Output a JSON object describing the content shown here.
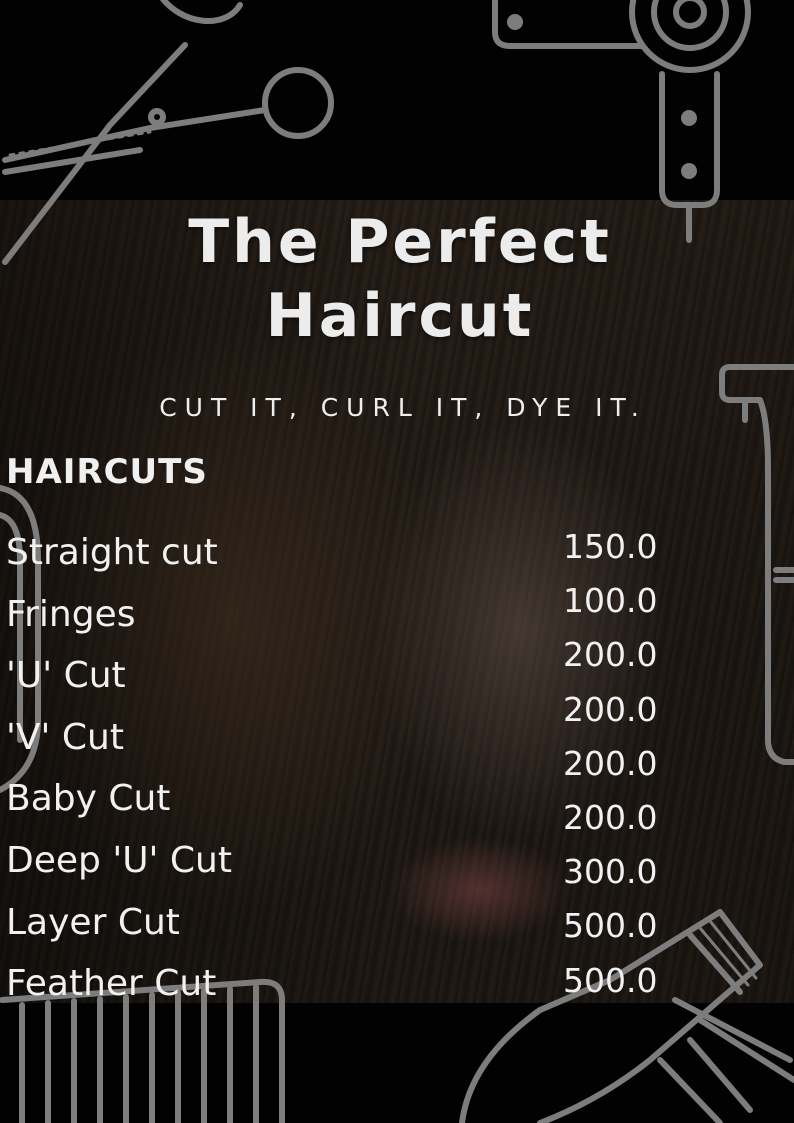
{
  "title_line1": "The Perfect",
  "title_line2": "Haircut",
  "tagline": "CUT IT, CURL IT, DYE IT.",
  "section": "HAIRCUTS",
  "menu": [
    {
      "name": "Straight cut",
      "price": "150.0"
    },
    {
      "name": "Fringes",
      "price": "100.0"
    },
    {
      "name": "'U' Cut",
      "price": "200.0"
    },
    {
      "name": "'V' Cut",
      "price": "200.0"
    },
    {
      "name": "Baby Cut",
      "price": "200.0"
    },
    {
      "name": "Deep 'U' Cut",
      "price": "300.0"
    },
    {
      "name": "Layer Cut",
      "price": "500.0"
    },
    {
      "name": "Feather Cut",
      "price": "500.0"
    }
  ],
  "extra_prices": [
    "200.0"
  ],
  "colors": {
    "background": "#000000",
    "text": "#f1f1f1",
    "line_art": "#7a7a7a"
  },
  "icons": [
    "scissors-icon",
    "hair-dryer-icon",
    "hair-clipper-icon",
    "comb-icon",
    "razor-icon"
  ]
}
